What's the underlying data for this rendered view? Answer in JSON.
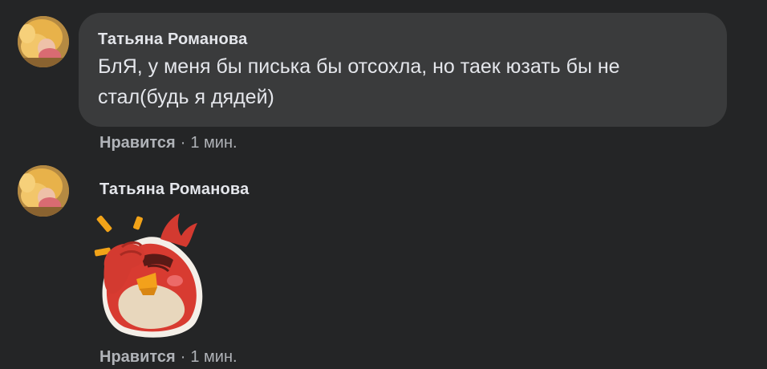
{
  "comments": [
    {
      "author": "Татьяна Романова",
      "text": "БлЯ, у меня бы писька бы отсохла, но таек юзать бы не стал(будь я дядей)",
      "like_label": "Нравится",
      "separator": "·",
      "time": "1 мин."
    },
    {
      "author": "Татьяна Романова",
      "sticker_icon": "red-angry-bird-facepalm-sticker",
      "like_label": "Нравится",
      "separator": "·",
      "time": "1 мин."
    }
  ],
  "colors": {
    "background": "#242526",
    "bubble": "#3a3b3c",
    "text_primary": "#e4e6eb",
    "text_secondary": "#b0b3b8"
  }
}
